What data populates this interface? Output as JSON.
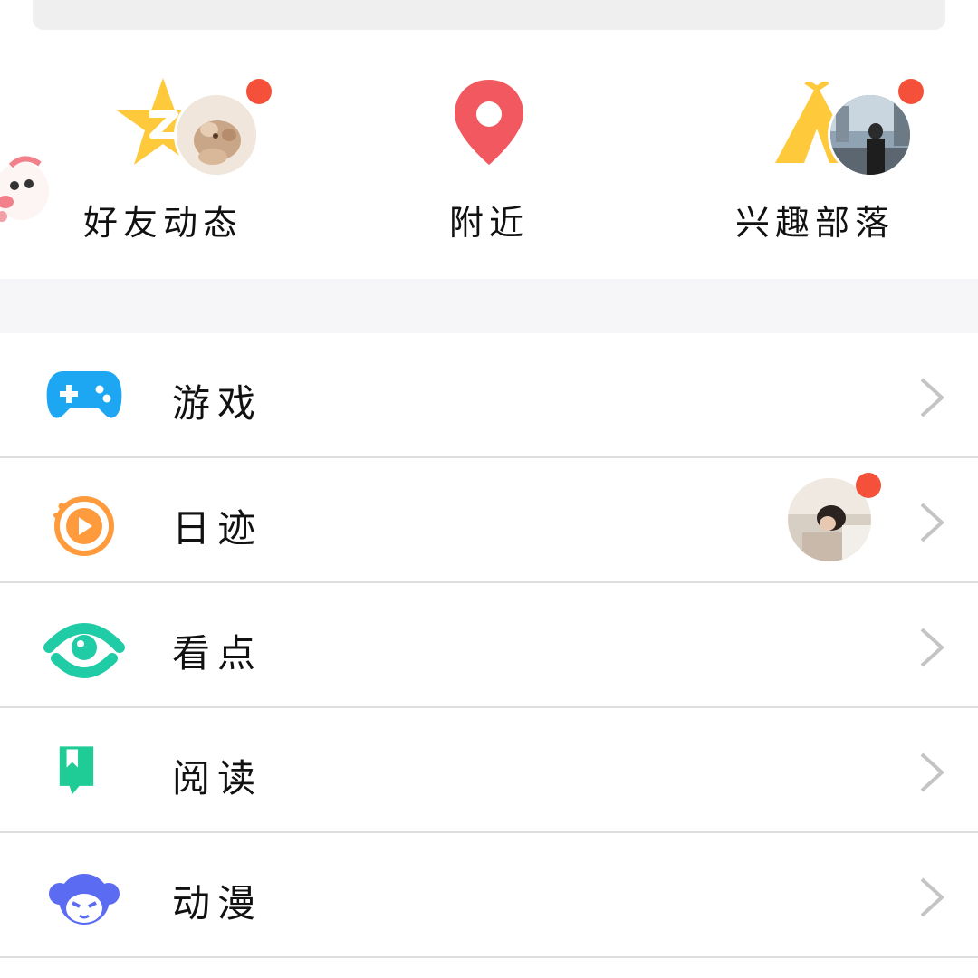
{
  "shortcuts": [
    {
      "label": "好友动态",
      "icon": "star-z-icon"
    },
    {
      "label": "附近",
      "icon": "location-pin-icon"
    },
    {
      "label": "兴趣部落",
      "icon": "tent-icon"
    }
  ],
  "menu": [
    {
      "label": "游戏",
      "icon": "gamepad-icon"
    },
    {
      "label": "日迹",
      "icon": "play-circle-icon"
    },
    {
      "label": "看点",
      "icon": "eye-icon"
    },
    {
      "label": "阅读",
      "icon": "bookmark-icon"
    },
    {
      "label": "动漫",
      "icon": "anime-face-icon"
    }
  ],
  "colors": {
    "badge": "#f4503a",
    "gamepad": "#1da7f2",
    "play": "#ff9a3d",
    "eye": "#1fcca6",
    "book": "#1fcc95",
    "anime": "#5b6cf2",
    "pin": "#f2585f",
    "star": "#ffc93c",
    "tent": "#ffc93c"
  }
}
